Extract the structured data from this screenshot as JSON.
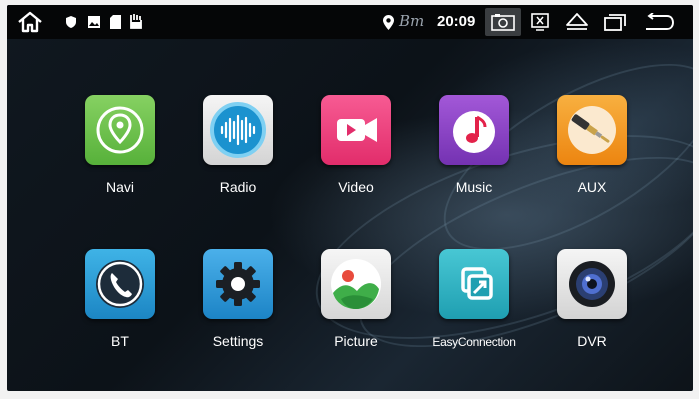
{
  "status_bar": {
    "icons_left": [
      "home-icon",
      "shield-notification-icon",
      "image-notification-icon",
      "sd-card-icon",
      "usb-hand-icon"
    ],
    "location_icon": "location-pin-icon",
    "bt_text": "Bт",
    "time": "20:09",
    "buttons": [
      "screenshot-icon",
      "close-window-icon",
      "eject-icon",
      "recent-apps-icon",
      "back-icon"
    ]
  },
  "apps": [
    {
      "id": "navi",
      "label": "Navi",
      "icon": "navi-icon"
    },
    {
      "id": "radio",
      "label": "Radio",
      "icon": "radio-icon"
    },
    {
      "id": "video",
      "label": "Video",
      "icon": "video-icon"
    },
    {
      "id": "music",
      "label": "Music",
      "icon": "music-icon"
    },
    {
      "id": "aux",
      "label": "AUX",
      "icon": "aux-icon"
    },
    {
      "id": "bt",
      "label": "BT",
      "icon": "bt-phone-icon"
    },
    {
      "id": "settings",
      "label": "Settings",
      "icon": "settings-gear-icon"
    },
    {
      "id": "picture",
      "label": "Picture",
      "icon": "picture-icon"
    },
    {
      "id": "easyconnection",
      "label": "EasyConnection",
      "icon": "easyconnection-icon"
    },
    {
      "id": "dvr",
      "label": "DVR",
      "icon": "dvr-camera-icon"
    }
  ],
  "colors": {
    "status_bar_bg": "#050607",
    "navi": "#6cc24a",
    "radio": "#e6e6e6",
    "video": "#ef3e7d",
    "music": "#8e44c8",
    "aux": "#f39a1f",
    "bt": "#2a9fd8",
    "settings": "#2f9bd9",
    "picture": "#e8e8e8",
    "easyconnection": "#2ab3c3",
    "dvr": "#e8e8e8"
  }
}
